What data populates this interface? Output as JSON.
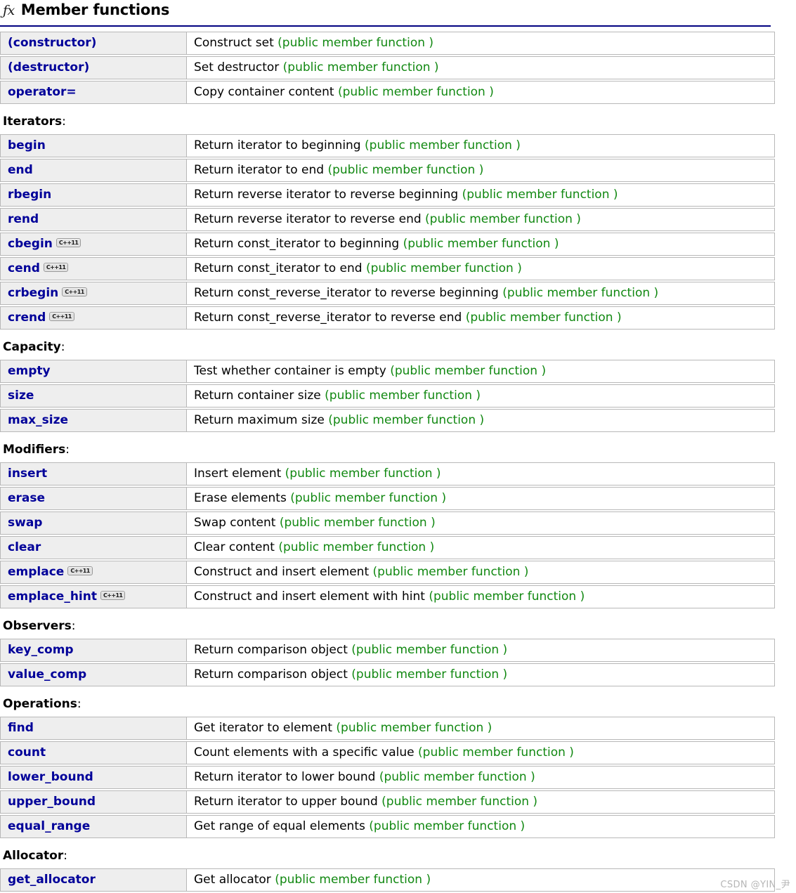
{
  "header": {
    "icon": "fx-icon",
    "icon_glyph": "ƒx",
    "title": "Member functions"
  },
  "colors": {
    "link": "#000099",
    "kind": "#118811",
    "rule": "#000080",
    "name_cell_bg": "#eeeeee",
    "border": "#b8b8b8",
    "badge_bg": "#e2e2e2",
    "watermark": "#b6b6b6"
  },
  "badge_label": "C++11",
  "groups": [
    {
      "label": "",
      "rows": [
        {
          "name": "(constructor)",
          "badge": false,
          "desc": "Construct set",
          "kind": "(public member function )"
        },
        {
          "name": "(destructor)",
          "badge": false,
          "desc": "Set destructor",
          "kind": "(public member function )"
        },
        {
          "name": "operator=",
          "badge": false,
          "desc": "Copy container content",
          "kind": "(public member function )"
        }
      ]
    },
    {
      "label": "Iterators",
      "label_suffix": ":",
      "rows": [
        {
          "name": "begin",
          "badge": false,
          "desc": "Return iterator to beginning",
          "kind": "(public member function )"
        },
        {
          "name": "end",
          "badge": false,
          "desc": "Return iterator to end",
          "kind": "(public member function )"
        },
        {
          "name": "rbegin",
          "badge": false,
          "desc": "Return reverse iterator to reverse beginning",
          "kind": "(public member function )"
        },
        {
          "name": "rend",
          "badge": false,
          "desc": "Return reverse iterator to reverse end",
          "kind": "(public member function )"
        },
        {
          "name": "cbegin",
          "badge": true,
          "desc": "Return const_iterator to beginning",
          "kind": "(public member function )"
        },
        {
          "name": "cend",
          "badge": true,
          "desc": "Return const_iterator to end",
          "kind": "(public member function )"
        },
        {
          "name": "crbegin",
          "badge": true,
          "desc": "Return const_reverse_iterator to reverse beginning",
          "kind": "(public member function )"
        },
        {
          "name": "crend",
          "badge": true,
          "desc": "Return const_reverse_iterator to reverse end",
          "kind": "(public member function )"
        }
      ]
    },
    {
      "label": "Capacity",
      "label_suffix": ":",
      "rows": [
        {
          "name": "empty",
          "badge": false,
          "desc": "Test whether container is empty",
          "kind": "(public member function )"
        },
        {
          "name": "size",
          "badge": false,
          "desc": "Return container size",
          "kind": "(public member function )"
        },
        {
          "name": "max_size",
          "badge": false,
          "desc": "Return maximum size",
          "kind": "(public member function )"
        }
      ]
    },
    {
      "label": "Modifiers",
      "label_suffix": ":",
      "rows": [
        {
          "name": "insert",
          "badge": false,
          "desc": "Insert element",
          "kind": "(public member function )"
        },
        {
          "name": "erase",
          "badge": false,
          "desc": "Erase elements",
          "kind": "(public member function )"
        },
        {
          "name": "swap",
          "badge": false,
          "desc": "Swap content",
          "kind": "(public member function )"
        },
        {
          "name": "clear",
          "badge": false,
          "desc": "Clear content",
          "kind": "(public member function )"
        },
        {
          "name": "emplace",
          "badge": true,
          "desc": "Construct and insert element",
          "kind": "(public member function )"
        },
        {
          "name": "emplace_hint",
          "badge": true,
          "desc": "Construct and insert element with hint",
          "kind": "(public member function )"
        }
      ]
    },
    {
      "label": "Observers",
      "label_suffix": ":",
      "rows": [
        {
          "name": "key_comp",
          "badge": false,
          "desc": "Return comparison object",
          "kind": "(public member function )"
        },
        {
          "name": "value_comp",
          "badge": false,
          "desc": "Return comparison object",
          "kind": "(public member function )"
        }
      ]
    },
    {
      "label": "Operations",
      "label_suffix": ":",
      "rows": [
        {
          "name": "find",
          "badge": false,
          "desc": "Get iterator to element",
          "kind": "(public member function )"
        },
        {
          "name": "count",
          "badge": false,
          "desc": "Count elements with a specific value",
          "kind": "(public member function )"
        },
        {
          "name": "lower_bound",
          "badge": false,
          "desc": "Return iterator to lower bound",
          "kind": "(public member function )"
        },
        {
          "name": "upper_bound",
          "badge": false,
          "desc": "Return iterator to upper bound",
          "kind": "(public member function )"
        },
        {
          "name": "equal_range",
          "badge": false,
          "desc": "Get range of equal elements",
          "kind": "(public member function )"
        }
      ]
    },
    {
      "label": "Allocator",
      "label_suffix": ":",
      "rows": [
        {
          "name": "get_allocator",
          "badge": false,
          "desc": "Get allocator",
          "kind": "(public member function )"
        }
      ]
    }
  ],
  "watermark": "CSDN @YIN_尹"
}
